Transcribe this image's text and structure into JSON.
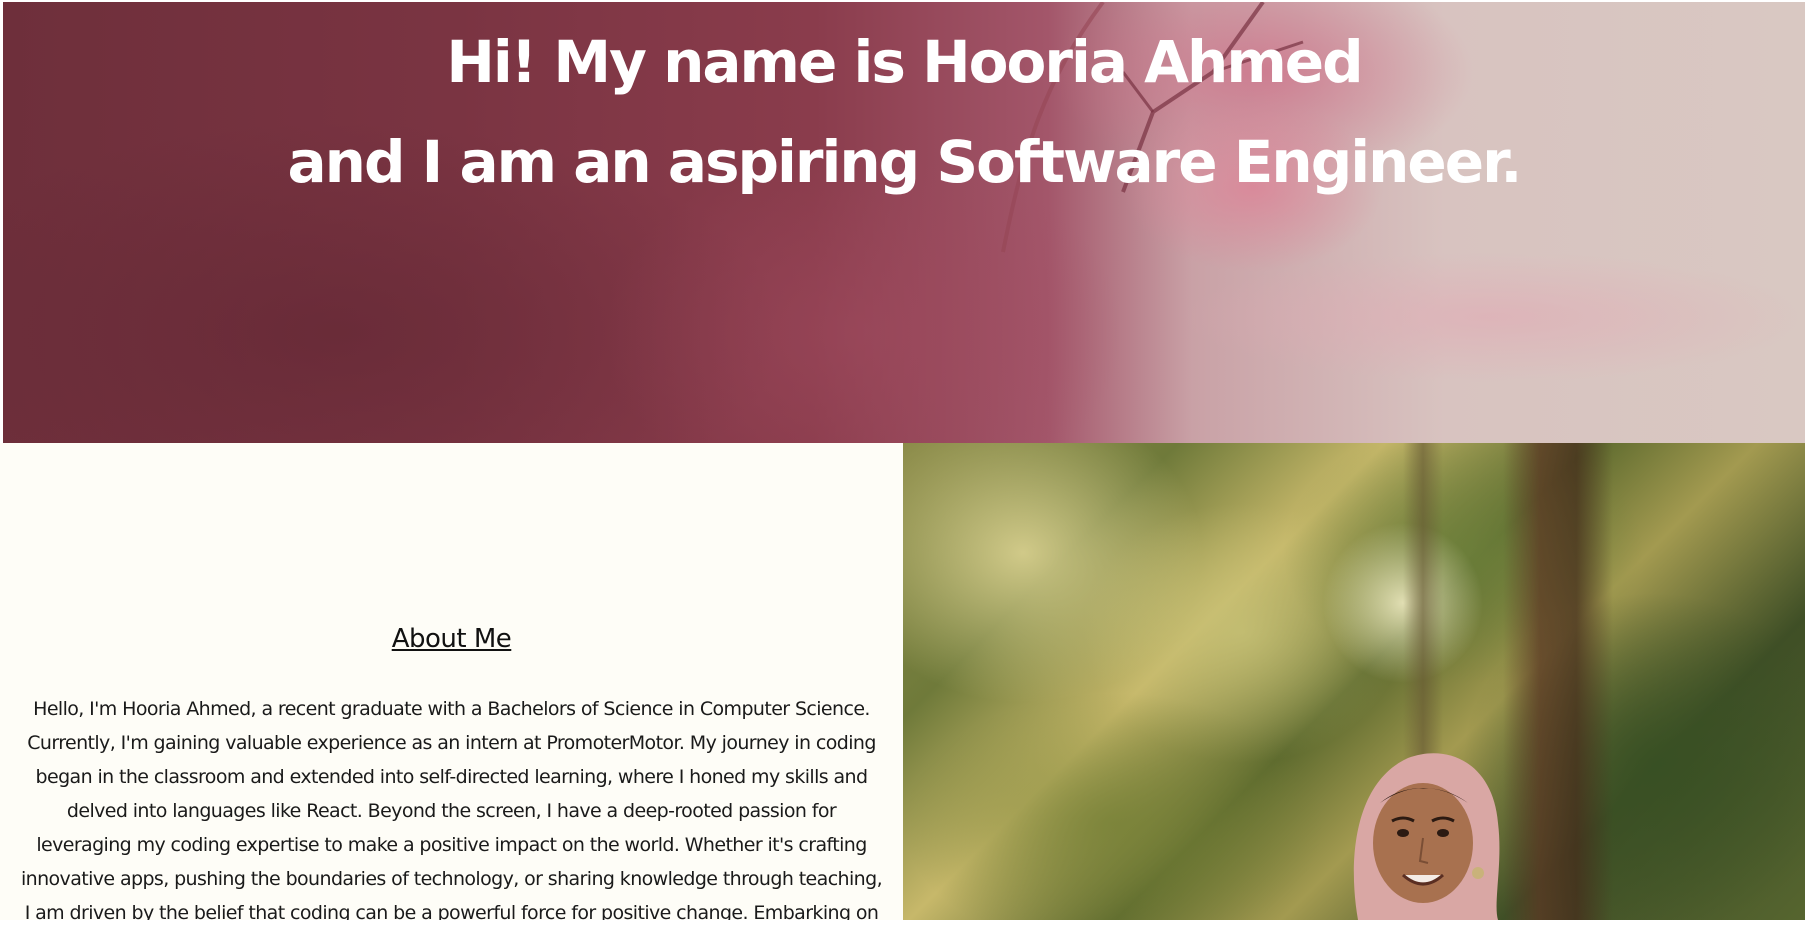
{
  "hero": {
    "line1": "Hi! My name is Hooria Ahmed",
    "line2": "and I am an aspiring Software Engineer."
  },
  "about": {
    "heading": "About Me",
    "lines": [
      "Hello, I'm Hooria Ahmed, a recent graduate with a Bachelors of Science in Computer Science.",
      "Currently, I'm gaining valuable experience as an intern at PromoterMotor. My journey in coding",
      "began in the classroom and extended into self-directed learning, where I honed my skills and",
      "delved into languages like React. Beyond the screen, I have a deep-rooted passion for",
      "leveraging my coding expertise to make a positive impact on the world. Whether it's crafting",
      "innovative apps, pushing the boundaries of technology, or sharing knowledge through teaching,",
      "I am driven by the belief that coding can be a powerful force for positive change. Embarking on"
    ]
  },
  "colors": {
    "hero_dark": "#6e2f3b",
    "hero_light": "#d9c8c2",
    "about_bg": "#fefdf7",
    "text": "#1a1a1a"
  }
}
